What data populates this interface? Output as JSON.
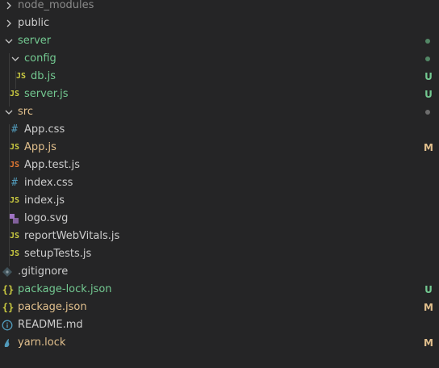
{
  "explorer": {
    "items": [
      {
        "label": "node_modules",
        "badge": ""
      },
      {
        "label": "public",
        "badge": ""
      },
      {
        "label": "server",
        "badge": ""
      },
      {
        "label": "config",
        "badge": ""
      },
      {
        "label": "db.js",
        "icon_text": "JS",
        "badge": "U"
      },
      {
        "label": "server.js",
        "icon_text": "JS",
        "badge": "U"
      },
      {
        "label": "src",
        "badge": ""
      },
      {
        "label": "App.css",
        "icon_text": "#",
        "badge": ""
      },
      {
        "label": "App.js",
        "icon_text": "JS",
        "badge": "M"
      },
      {
        "label": "App.test.js",
        "icon_text": "JS",
        "badge": ""
      },
      {
        "label": "index.css",
        "icon_text": "#",
        "badge": ""
      },
      {
        "label": "index.js",
        "icon_text": "JS",
        "badge": ""
      },
      {
        "label": "logo.svg",
        "badge": ""
      },
      {
        "label": "reportWebVitals.js",
        "icon_text": "JS",
        "badge": ""
      },
      {
        "label": "setupTests.js",
        "icon_text": "JS",
        "badge": ""
      },
      {
        "label": ".gitignore",
        "badge": ""
      },
      {
        "label": "package-lock.json",
        "icon_text": "{}",
        "badge": "U"
      },
      {
        "label": "package.json",
        "icon_text": "{}",
        "badge": "M"
      },
      {
        "label": "README.md",
        "badge": ""
      },
      {
        "label": "yarn.lock",
        "badge": "M"
      }
    ]
  },
  "colors": {
    "background": "#252526",
    "untracked": "#73c991",
    "modified": "#e2c08d",
    "js_icon": "#cbcb41",
    "css_icon": "#519aba"
  }
}
